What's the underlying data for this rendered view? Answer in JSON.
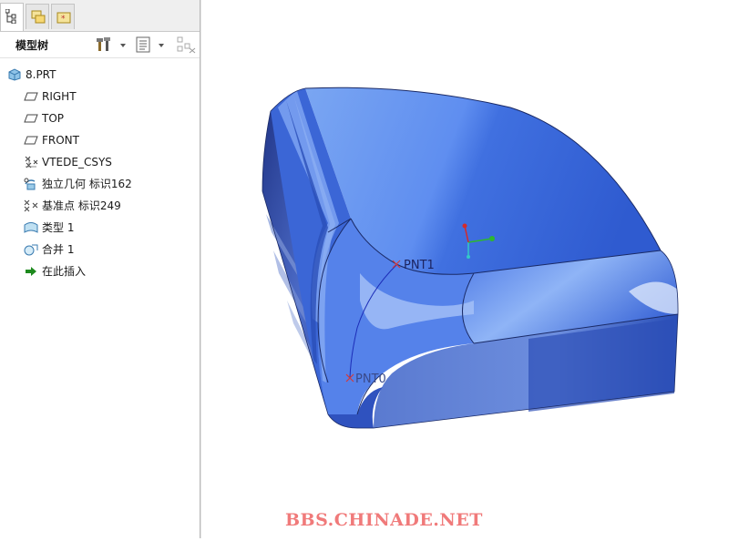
{
  "panel": {
    "title": "模型树",
    "tabs": [
      {
        "name": "model-tree-tab",
        "icon": "tree-icon"
      },
      {
        "name": "folder-browser-tab",
        "icon": "folder-icon"
      },
      {
        "name": "favorites-tab",
        "icon": "favorites-icon"
      }
    ],
    "tools": [
      "settings-icon",
      "show-icon",
      "filter-icon"
    ]
  },
  "tree": {
    "items": [
      {
        "label": "8.PRT",
        "icon": "part-icon"
      },
      {
        "label": "RIGHT",
        "icon": "datum-plane-icon"
      },
      {
        "label": "TOP",
        "icon": "datum-plane-icon"
      },
      {
        "label": "FRONT",
        "icon": "datum-plane-icon"
      },
      {
        "label": "VTEDE_CSYS",
        "icon": "coordinate-system-icon"
      },
      {
        "label": "独立几何 标识162",
        "icon": "independent-geometry-icon"
      },
      {
        "label": "基准点 标识249",
        "icon": "datum-point-icon"
      },
      {
        "label": "类型 1",
        "icon": "style-surface-icon"
      },
      {
        "label": "合并 1",
        "icon": "merge-icon"
      },
      {
        "label": "在此插入",
        "icon": "insert-here-arrow-icon"
      }
    ]
  },
  "viewport": {
    "point_labels": [
      "PNT1",
      "PNT0"
    ],
    "model_color": "#3a64d8"
  },
  "watermark": "BBS.CHINADE.NET"
}
